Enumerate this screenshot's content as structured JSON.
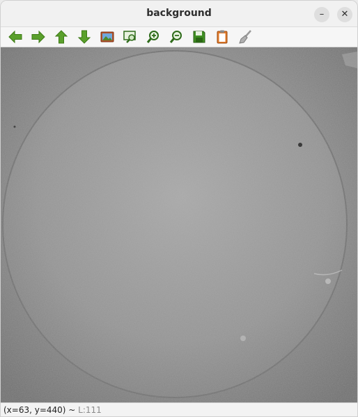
{
  "window": {
    "title": "background",
    "minimize_label": "–",
    "close_label": "✕"
  },
  "toolbar": {
    "buttons": [
      {
        "name": "back-arrow-icon",
        "color": "#4e9a06"
      },
      {
        "name": "forward-arrow-icon",
        "color": "#4e9a06"
      },
      {
        "name": "up-arrow-icon",
        "color": "#4e9a06"
      },
      {
        "name": "down-arrow-icon",
        "color": "#4e9a06"
      },
      {
        "name": "image-icon",
        "color": "#c05020"
      },
      {
        "name": "zoom-rect-icon",
        "color": "#2e7d32"
      },
      {
        "name": "zoom-in-icon",
        "color": "#2e7d32"
      },
      {
        "name": "zoom-out-icon",
        "color": "#2e7d32"
      },
      {
        "name": "save-icon",
        "color": "#2e7d32"
      },
      {
        "name": "clipboard-icon",
        "color": "#e07020"
      },
      {
        "name": "brush-icon",
        "color": "#808080"
      }
    ]
  },
  "status": {
    "coords": "(x=63, y=440) ~ ",
    "level": "L:111"
  }
}
